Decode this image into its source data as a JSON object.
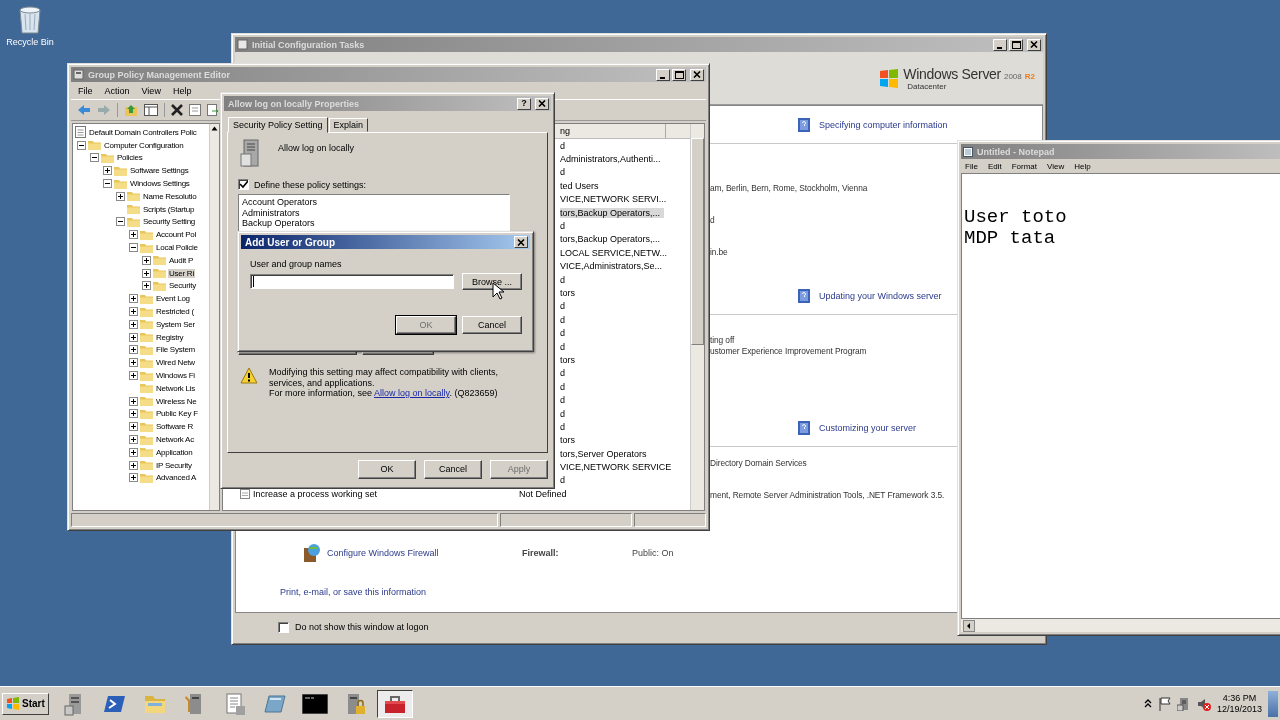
{
  "desktop": {
    "icon_label": "Recycle Bin"
  },
  "config_window": {
    "title": "Initial Configuration Tasks",
    "active": false,
    "logo": {
      "brand": "Windows Server",
      "year": "2008",
      "release": "R2",
      "edition": "Datacenter"
    },
    "sections": [
      {
        "heading": "Specifying computer information",
        "lines": [
          "am, Berlin, Bern, Rome, Stockholm, Vienna",
          "d",
          "in.be"
        ]
      },
      {
        "heading": "Updating your Windows server",
        "lines": [
          "ting off",
          "ustomer Experience Improvement Program"
        ]
      },
      {
        "heading": "Customizing your server",
        "lines": [
          "Directory Domain Services",
          "ment, Remote Server Administration Tools, .NET Framework 3.5."
        ]
      }
    ],
    "firewall": {
      "link": "Configure Windows Firewall",
      "label": "Firewall:",
      "value": "Public: On"
    },
    "print_link": "Print, e-mail, or save this information",
    "logon_option": {
      "label": "Do not show this window at logon",
      "checked": false
    }
  },
  "policy_editor": {
    "title": "Group Policy Management Editor",
    "active": false,
    "menu": [
      "File",
      "Action",
      "View",
      "Help"
    ],
    "tree": [
      {
        "label": "Default Domain Controllers Polic",
        "selected": false,
        "children": [
          {
            "label": "Computer Configuration",
            "expanded": true,
            "selected": false,
            "children": [
              {
                "label": "Policies",
                "expanded": true,
                "selected": false,
                "children": [
                  {
                    "label": "Software Settings",
                    "expanded": false,
                    "selected": false
                  },
                  {
                    "label": "Windows Settings",
                    "expanded": true,
                    "selected": false,
                    "children": [
                      {
                        "label": "Name Resolutio",
                        "expanded": false,
                        "selected": false
                      },
                      {
                        "label": "Scripts (Startup",
                        "selected": false
                      },
                      {
                        "label": "Security Setting",
                        "expanded": true,
                        "selected": false,
                        "children": [
                          {
                            "label": "Account Pol",
                            "expanded": false,
                            "selected": false
                          },
                          {
                            "label": "Local Policie",
                            "expanded": true,
                            "selected": false,
                            "children": [
                              {
                                "label": "Audit P",
                                "expanded": false,
                                "selected": false
                              },
                              {
                                "label": "User Ri",
                                "expanded": false,
                                "selected": true
                              },
                              {
                                "label": "Security",
                                "expanded": false,
                                "selected": false
                              }
                            ]
                          },
                          {
                            "label": "Event Log",
                            "expanded": false,
                            "selected": false
                          },
                          {
                            "label": "Restricted (",
                            "expanded": false,
                            "selected": false
                          },
                          {
                            "label": "System Ser",
                            "expanded": false,
                            "selected": false
                          },
                          {
                            "label": "Registry",
                            "expanded": false,
                            "selected": false
                          },
                          {
                            "label": "File System",
                            "expanded": false,
                            "selected": false
                          },
                          {
                            "label": "Wired Netw",
                            "expanded": false,
                            "selected": false
                          },
                          {
                            "label": "Windows Fi",
                            "expanded": false,
                            "selected": false
                          },
                          {
                            "label": "Network Lis",
                            "selected": false
                          },
                          {
                            "label": "Wireless Ne",
                            "expanded": false,
                            "selected": false
                          },
                          {
                            "label": "Public Key F",
                            "expanded": false,
                            "selected": false
                          },
                          {
                            "label": "Software R",
                            "expanded": false,
                            "selected": false
                          },
                          {
                            "label": "Network Ac",
                            "expanded": false,
                            "selected": false
                          },
                          {
                            "label": "Application",
                            "expanded": false,
                            "selected": false
                          },
                          {
                            "label": "IP Security",
                            "expanded": false,
                            "selected": false
                          },
                          {
                            "label": "Advanced A",
                            "expanded": false,
                            "selected": false
                          }
                        ]
                      }
                    ]
                  }
                ]
              }
            ]
          }
        ]
      }
    ],
    "list": {
      "column": "ng",
      "rows": [
        {
          "setting": "d",
          "selected": false
        },
        {
          "setting": "Administrators,Authenti...",
          "selected": false
        },
        {
          "setting": "d",
          "selected": false
        },
        {
          "setting": "ted Users",
          "selected": false
        },
        {
          "setting": "VICE,NETWORK SERVI...",
          "selected": false
        },
        {
          "setting": "tors,Backup Operators,...",
          "selected": true
        },
        {
          "setting": "d",
          "selected": false
        },
        {
          "setting": "tors,Backup Operators,...",
          "selected": false
        },
        {
          "setting": "LOCAL SERVICE,NETW...",
          "selected": false
        },
        {
          "setting": "VICE,Administrators,Se...",
          "selected": false
        },
        {
          "setting": "d",
          "selected": false
        },
        {
          "setting": "tors",
          "selected": false
        },
        {
          "setting": "d",
          "selected": false
        },
        {
          "setting": "d",
          "selected": false
        },
        {
          "setting": "d",
          "selected": false
        },
        {
          "setting": "d",
          "selected": false
        },
        {
          "setting": "tors",
          "selected": false
        },
        {
          "setting": "d",
          "selected": false
        },
        {
          "setting": "d",
          "selected": false
        },
        {
          "setting": "d",
          "selected": false
        },
        {
          "setting": "d",
          "selected": false
        },
        {
          "setting": "d",
          "selected": false
        },
        {
          "setting": "tors",
          "selected": false
        },
        {
          "setting": "tors,Server Operators",
          "selected": false
        },
        {
          "setting": "VICE,NETWORK SERVICE",
          "selected": false
        },
        {
          "setting": "d",
          "selected": false
        },
        {
          "policy": "Increase a process working set",
          "setting": "Not Defined",
          "selected": false
        }
      ]
    }
  },
  "properties_dialog": {
    "title": "Allow log on locally Properties",
    "active": false,
    "help_button": "?",
    "tabs": [
      {
        "label": "Security Policy Setting",
        "selected": true
      },
      {
        "label": "Explain",
        "selected": false
      }
    ],
    "policy_name": "Allow log on locally",
    "define": {
      "label": "Define these policy settings:",
      "checked": true
    },
    "members": [
      "Account Operators",
      "Administrators",
      "Backup Operators"
    ],
    "warning": "Modifying this setting may affect compatibility with clients, services, and applications.",
    "more_info": {
      "prefix": "For more information, see",
      "link": "Allow log on locally",
      "suffix": ". (Q823659)"
    },
    "buttons": [
      {
        "label": "OK",
        "disabled": false
      },
      {
        "label": "Cancel",
        "disabled": false
      },
      {
        "label": "Apply",
        "disabled": true
      }
    ]
  },
  "add_dialog": {
    "title": "Add User or Group",
    "active": true,
    "field_label": "User and group names",
    "browse": "Browse ...",
    "buttons": [
      {
        "label": "OK",
        "disabled": true
      },
      {
        "label": "Cancel",
        "disabled": false
      }
    ]
  },
  "notepad": {
    "title": "Untitled - Notepad",
    "active": false,
    "menu": [
      "File",
      "Edit",
      "Format",
      "View",
      "Help"
    ],
    "text": "User toto\nMDP tata"
  },
  "taskbar": {
    "start": "Start",
    "apps": [
      {
        "kind": "server",
        "selected": false
      },
      {
        "kind": "shell",
        "selected": false
      },
      {
        "kind": "folder",
        "selected": false
      },
      {
        "kind": "tools",
        "selected": false
      },
      {
        "kind": "document",
        "selected": false
      },
      {
        "kind": "disk",
        "selected": false
      },
      {
        "kind": "console",
        "selected": false
      },
      {
        "kind": "lock",
        "selected": false
      },
      {
        "kind": "toolbox",
        "selected": true
      }
    ],
    "time": "4:36 PM",
    "date": "12/19/2013"
  }
}
